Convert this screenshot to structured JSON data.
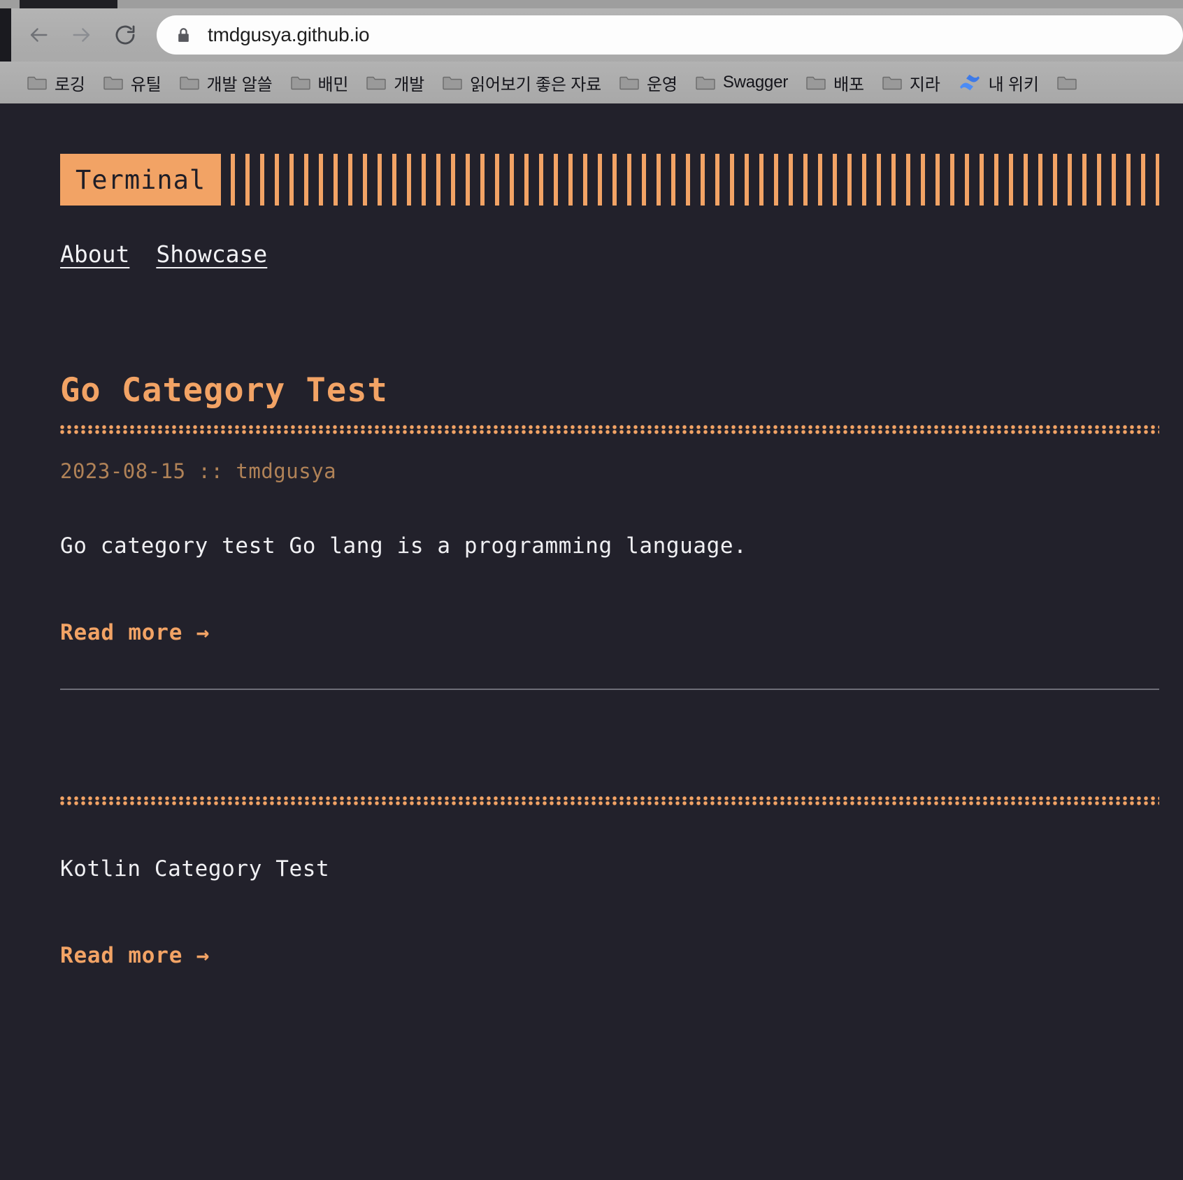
{
  "browser": {
    "back_icon": "arrow-left-icon",
    "forward_icon": "arrow-right-icon",
    "reload_icon": "reload-icon",
    "lock_icon": "lock-icon",
    "url": "tmdgusya.github.io",
    "bookmarks": [
      {
        "label": "로깅",
        "icon": "folder-icon"
      },
      {
        "label": "유틸",
        "icon": "folder-icon"
      },
      {
        "label": "개발 알쓸",
        "icon": "folder-icon"
      },
      {
        "label": "배민",
        "icon": "folder-icon"
      },
      {
        "label": "개발",
        "icon": "folder-icon"
      },
      {
        "label": "읽어보기 좋은 자료",
        "icon": "folder-icon"
      },
      {
        "label": "운영",
        "icon": "folder-icon"
      },
      {
        "label": "Swagger",
        "icon": "folder-icon"
      },
      {
        "label": "배포",
        "icon": "folder-icon"
      },
      {
        "label": "지라",
        "icon": "folder-icon"
      },
      {
        "label": "내 위키",
        "icon": "confluence-icon"
      },
      {
        "label": "",
        "icon": "folder-icon"
      }
    ]
  },
  "site": {
    "logo": "Terminal",
    "nav": [
      {
        "label": "About"
      },
      {
        "label": "Showcase"
      }
    ]
  },
  "posts": [
    {
      "title": "Go Category Test",
      "meta": "2023-08-15 :: tmdgusya",
      "body": "Go category test Go lang is a programming language.",
      "read_more": "Read more →"
    },
    {
      "title": "",
      "meta": "",
      "body": "Kotlin Category Test",
      "read_more": "Read more →"
    }
  ],
  "colors": {
    "background": "#22212b",
    "accent": "#f2a365",
    "text": "#f0f0f3",
    "meta": "#b08257",
    "separator": "#6e6e78"
  }
}
